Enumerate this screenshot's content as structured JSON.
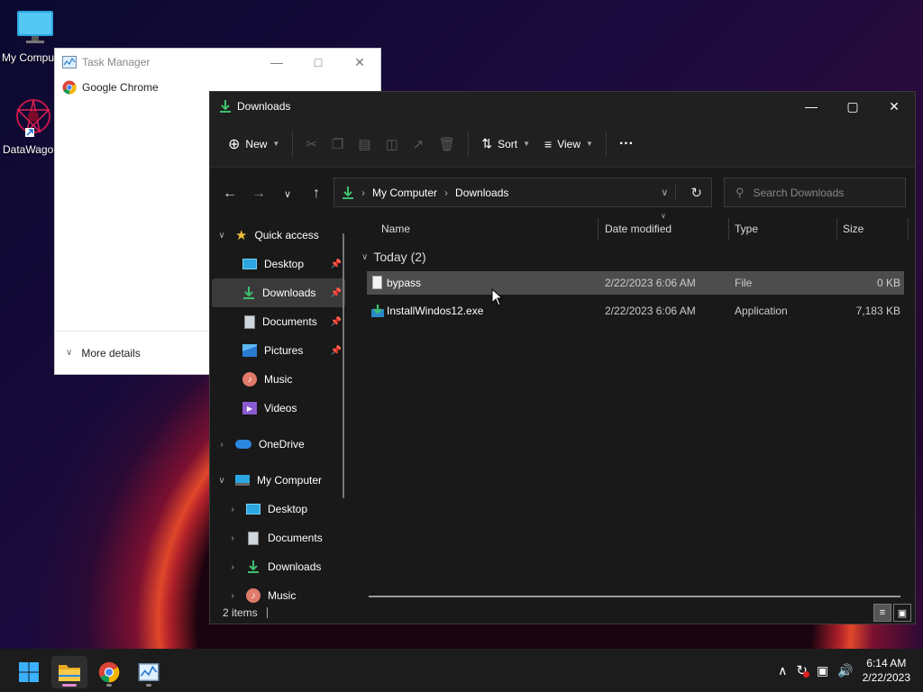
{
  "desktop": {
    "icons": [
      {
        "label": "My Computer",
        "icon": "monitor-icon"
      },
      {
        "label": "DataWagon",
        "icon": "datawagon-icon"
      }
    ]
  },
  "task_manager": {
    "title": "Task Manager",
    "apps": [
      {
        "label": "Google Chrome",
        "icon": "chrome-icon"
      }
    ],
    "more_details": "More details"
  },
  "explorer": {
    "title": "Downloads",
    "toolbar": {
      "new_label": "New",
      "sort_label": "Sort",
      "view_label": "View",
      "more_label": "···"
    },
    "breadcrumb": [
      "My Computer",
      "Downloads"
    ],
    "search_placeholder": "Search Downloads",
    "nav": {
      "quick_access": "Quick access",
      "quick_items": [
        {
          "label": "Desktop",
          "pinned": true
        },
        {
          "label": "Downloads",
          "pinned": true,
          "selected": true
        },
        {
          "label": "Documents",
          "pinned": true
        },
        {
          "label": "Pictures",
          "pinned": true
        },
        {
          "label": "Music",
          "pinned": false
        },
        {
          "label": "Videos",
          "pinned": false
        }
      ],
      "onedrive": "OneDrive",
      "my_computer": "My Computer",
      "computer_items": [
        "Desktop",
        "Documents",
        "Downloads",
        "Music"
      ]
    },
    "columns": {
      "name": "Name",
      "date": "Date modified",
      "type": "Type",
      "size": "Size"
    },
    "group_label": "Today (2)",
    "files": [
      {
        "name": "bypass",
        "date": "2/22/2023 6:06 AM",
        "type": "File",
        "size": "0 KB",
        "selected": true
      },
      {
        "name": "InstallWindos12.exe",
        "date": "2/22/2023 6:06 AM",
        "type": "Application",
        "size": "7,183 KB",
        "selected": false
      }
    ],
    "status": "2 items"
  },
  "taskbar": {
    "time": "6:14 AM",
    "date": "2/22/2023"
  },
  "colors": {
    "accent": "#3aa0e6",
    "folder": "#f0c03a",
    "download_green": "#3ec06e"
  }
}
